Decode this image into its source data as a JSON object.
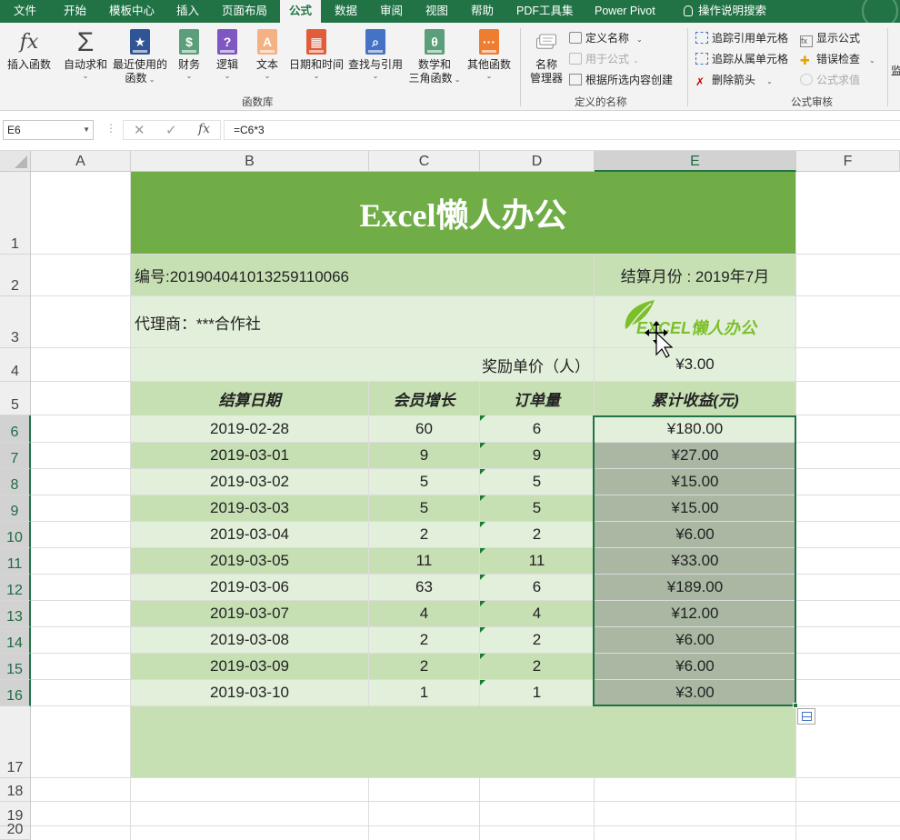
{
  "ribbon": {
    "tabs": [
      "文件",
      "开始",
      "模板中心",
      "插入",
      "页面布局",
      "公式",
      "数据",
      "审阅",
      "视图",
      "帮助",
      "PDF工具集",
      "Power Pivot",
      "操作说明搜索"
    ],
    "active_tab": "公式",
    "function_library": {
      "insert_function": "插入函数",
      "autosum": "自动求和",
      "recent_1": "最近使用的",
      "recent_2": "函数",
      "financial": "财务",
      "logical": "逻辑",
      "text": "文本",
      "datetime": "日期和时间",
      "lookup": "查找与引用",
      "math_1": "数学和",
      "math_2": "三角函数",
      "more": "其他函数",
      "group_label": "函数库"
    },
    "defined_names": {
      "name_manager_1": "名称",
      "name_manager_2": "管理器",
      "define_name": "定义名称",
      "use_in_formula": "用于公式",
      "create_from_selection": "根据所选内容创建",
      "group_label": "定义的名称"
    },
    "formula_auditing": {
      "trace_precedents": "追踪引用单元格",
      "trace_dependents": "追踪从属单元格",
      "remove_arrows": "删除箭头",
      "show_formulas": "显示公式",
      "error_checking": "错误检查",
      "evaluate_formula": "公式求值",
      "group_label": "公式审核",
      "watch_partial": "监"
    }
  },
  "formula_bar": {
    "name_box": "E6",
    "formula": "=C6*3",
    "fx": "fx"
  },
  "columns": [
    "A",
    "B",
    "C",
    "D",
    "E",
    "F"
  ],
  "rows": [
    "1",
    "2",
    "3",
    "4",
    "5",
    "6",
    "7",
    "8",
    "9",
    "10",
    "11",
    "12",
    "13",
    "14",
    "15",
    "16",
    "17",
    "18",
    "19",
    "20"
  ],
  "sheet": {
    "title": "Excel懒人办公",
    "serial": "编号:201904041013259110066",
    "settle_month": "结算月份 : 2019年7月",
    "agent": "代理商：***合作社",
    "logo_text": "EXCEL懒人办公",
    "reward_label": "奖励单价（人）",
    "reward_value": "¥3.00",
    "headers": [
      "结算日期",
      "会员增长",
      "订单量",
      "累计收益(元)"
    ],
    "records": [
      {
        "date": "2019-02-28",
        "members": "60",
        "orders": "6",
        "income": "¥180.00"
      },
      {
        "date": "2019-03-01",
        "members": "9",
        "orders": "9",
        "income": "¥27.00"
      },
      {
        "date": "2019-03-02",
        "members": "5",
        "orders": "5",
        "income": "¥15.00"
      },
      {
        "date": "2019-03-03",
        "members": "5",
        "orders": "5",
        "income": "¥15.00"
      },
      {
        "date": "2019-03-04",
        "members": "2",
        "orders": "2",
        "income": "¥6.00"
      },
      {
        "date": "2019-03-05",
        "members": "11",
        "orders": "11",
        "income": "¥33.00"
      },
      {
        "date": "2019-03-06",
        "members": "63",
        "orders": "6",
        "income": "¥189.00"
      },
      {
        "date": "2019-03-07",
        "members": "4",
        "orders": "4",
        "income": "¥12.00"
      },
      {
        "date": "2019-03-08",
        "members": "2",
        "orders": "2",
        "income": "¥6.00"
      },
      {
        "date": "2019-03-09",
        "members": "2",
        "orders": "2",
        "income": "¥6.00"
      },
      {
        "date": "2019-03-10",
        "members": "1",
        "orders": "1",
        "income": "¥3.00"
      }
    ]
  },
  "colors": {
    "excel_green": "#217346",
    "title_fill": "#70ad47",
    "band_mid": "#c6e0b4",
    "band_light": "#e2efda",
    "selection_tint": "#a9b7a3"
  }
}
